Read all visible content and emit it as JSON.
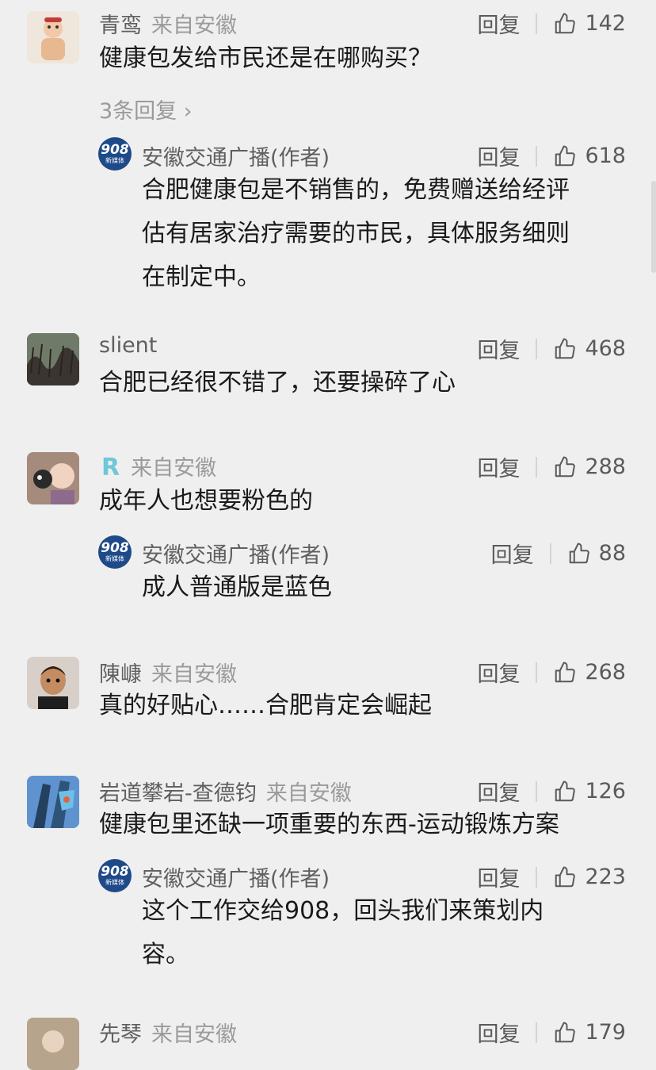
{
  "comments": [
    {
      "name": "青鸾",
      "location": "来自安徽",
      "reply_label": "回复",
      "likes": "142",
      "text": "健康包发给市民还是在哪购买？",
      "more_replies": "3条回复",
      "reply": {
        "avatar_num": "908",
        "avatar_sub": "新媒体",
        "name": "安徽交通广播(作者)",
        "reply_label": "回复",
        "likes": "618",
        "lines": [
          "合肥健康包是不销售的，免费赠送给经评",
          "估有居家治疗需要的市民，具体服务细则",
          "在制定中。"
        ]
      }
    },
    {
      "name": "slient",
      "reply_label": "回复",
      "likes": "468",
      "text": "合肥已经很不错了，还要操碎了心"
    },
    {
      "name_logo": "R",
      "location": "来自安徽",
      "reply_label": "回复",
      "likes": "288",
      "text": "成年人也想要粉色的",
      "reply": {
        "avatar_num": "908",
        "avatar_sub": "新媒体",
        "name": "安徽交通广播(作者)",
        "reply_label": "回复",
        "likes": "88",
        "lines": [
          "成人普通版是蓝色"
        ]
      }
    },
    {
      "name": "陳嵻",
      "location": "来自安徽",
      "reply_label": "回复",
      "likes": "268",
      "text": "真的好贴心……合肥肯定会崛起"
    },
    {
      "name": "岩道攀岩-查德钧",
      "location": "来自安徽",
      "reply_label": "回复",
      "likes": "126",
      "text": "健康包里还缺一项重要的东西-运动锻炼方案",
      "reply": {
        "avatar_num": "908",
        "avatar_sub": "新媒体",
        "name": "安徽交通广播(作者)",
        "reply_label": "回复",
        "likes": "223",
        "lines": [
          "这个工作交给908，回头我们来策划内",
          "容。"
        ]
      }
    },
    {
      "name": "先琴",
      "location": "来自安徽",
      "reply_label": "回复",
      "likes": "179"
    }
  ],
  "colors": {
    "background": "#efefef",
    "text": "#1a1a1a",
    "muted": "#9a9a9a",
    "author_avatar": "#1e4a8a"
  },
  "icons": {
    "like": "thumbs-up-icon",
    "chevron": "chevron-right-icon"
  }
}
